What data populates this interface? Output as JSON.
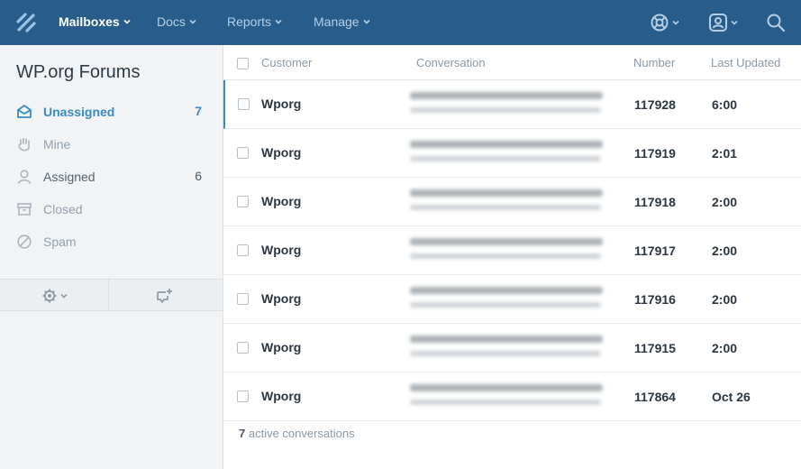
{
  "nav": {
    "items": [
      {
        "label": "Mailboxes"
      },
      {
        "label": "Docs"
      },
      {
        "label": "Reports"
      },
      {
        "label": "Manage"
      }
    ]
  },
  "sidebar": {
    "title": "WP.org Forums",
    "items": [
      {
        "label": "Unassigned",
        "count": "7"
      },
      {
        "label": "Mine",
        "count": ""
      },
      {
        "label": "Assigned",
        "count": "6"
      },
      {
        "label": "Closed",
        "count": ""
      },
      {
        "label": "Spam",
        "count": ""
      }
    ]
  },
  "table": {
    "headers": {
      "customer": "Customer",
      "conversation": "Conversation",
      "number": "Number",
      "updated": "Last Updated"
    },
    "rows": [
      {
        "customer": "Wporg",
        "number": "117928",
        "updated": "6:00"
      },
      {
        "customer": "Wporg",
        "number": "117919",
        "updated": "2:01"
      },
      {
        "customer": "Wporg",
        "number": "117918",
        "updated": "2:00"
      },
      {
        "customer": "Wporg",
        "number": "117917",
        "updated": "2:00"
      },
      {
        "customer": "Wporg",
        "number": "117916",
        "updated": "2:00"
      },
      {
        "customer": "Wporg",
        "number": "117915",
        "updated": "2:00"
      },
      {
        "customer": "Wporg",
        "number": "117864",
        "updated": "Oct 26"
      }
    ],
    "footer": {
      "count": "7",
      "text": " active conversations"
    }
  },
  "colors": {
    "navbar": "#285d8b",
    "accent": "#3a8bc3",
    "sidebar_bg": "#f1f3f5"
  },
  "icons": [
    "logo-icon",
    "chevron-down-icon",
    "help-lifebuoy-icon",
    "user-profile-icon",
    "search-icon",
    "inbox-icon",
    "hand-icon",
    "person-icon",
    "archive-icon",
    "spam-icon",
    "gear-icon",
    "new-conversation-icon"
  ]
}
